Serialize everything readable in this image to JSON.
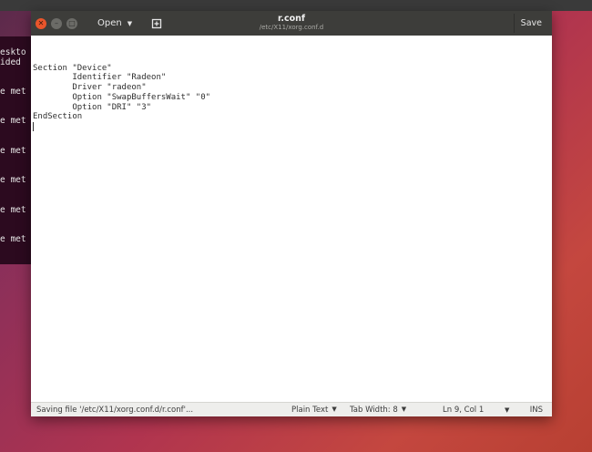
{
  "terminal": {
    "lines": [
      "eskto",
      "ided",
      "e met",
      "e met",
      "e met",
      "e met",
      "e met",
      "e met"
    ]
  },
  "editor": {
    "open_label": "Open",
    "filename": "r.conf",
    "path": "/etc/X11/xorg.conf.d",
    "save_label": "Save",
    "content": "\nSection \"Device\"\n        Identifier \"Radeon\"\n        Driver \"radeon\"\n        Option \"SwapBuffersWait\" \"0\"\n        Option \"DRI\" \"3\"\nEndSection\n"
  },
  "status": {
    "message": "Saving file '/etc/X11/xorg.conf.d/r.conf'...",
    "language": "Plain Text",
    "tab_width": "Tab Width: 8",
    "position": "Ln 9, Col 1",
    "mode": "INS"
  },
  "icons": {
    "close": "close-icon",
    "minimize": "minimize-icon",
    "maximize": "maximize-icon",
    "new_document": "new-document-icon",
    "dropdown": "chevron-down-icon"
  },
  "colors": {
    "close_button": "#e9552b",
    "titlebar": "#3d3d3a",
    "terminal_bg": "#2c0a1f"
  }
}
